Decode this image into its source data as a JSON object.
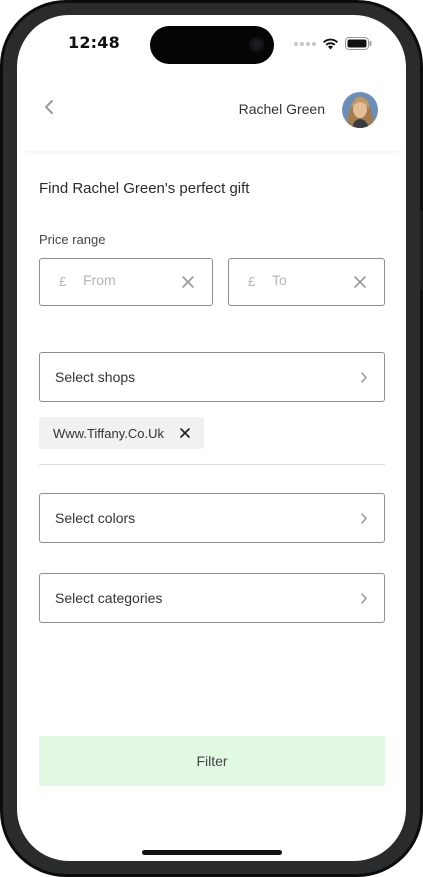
{
  "status_bar": {
    "time": "12:48"
  },
  "header": {
    "back_icon": "chevron-left-icon",
    "user_name": "Rachel Green"
  },
  "form": {
    "title": "Find Rachel Green's perfect gift",
    "price_range_label": "Price range",
    "price_from": {
      "currency": "£",
      "placeholder": "From",
      "value": ""
    },
    "price_to": {
      "currency": "£",
      "placeholder": "To",
      "value": ""
    },
    "shops_select": {
      "label": "Select shops"
    },
    "selected_shops": [
      {
        "label": "Www.Tiffany.Co.Uk"
      }
    ],
    "colors_select": {
      "label": "Select colors"
    },
    "categories_select": {
      "label": "Select categories"
    },
    "filter_button": "Filter"
  },
  "colors": {
    "filter_button_bg": "#e1f8e3",
    "field_border": "#8f8f8f",
    "chip_bg": "#f1f1f1"
  }
}
